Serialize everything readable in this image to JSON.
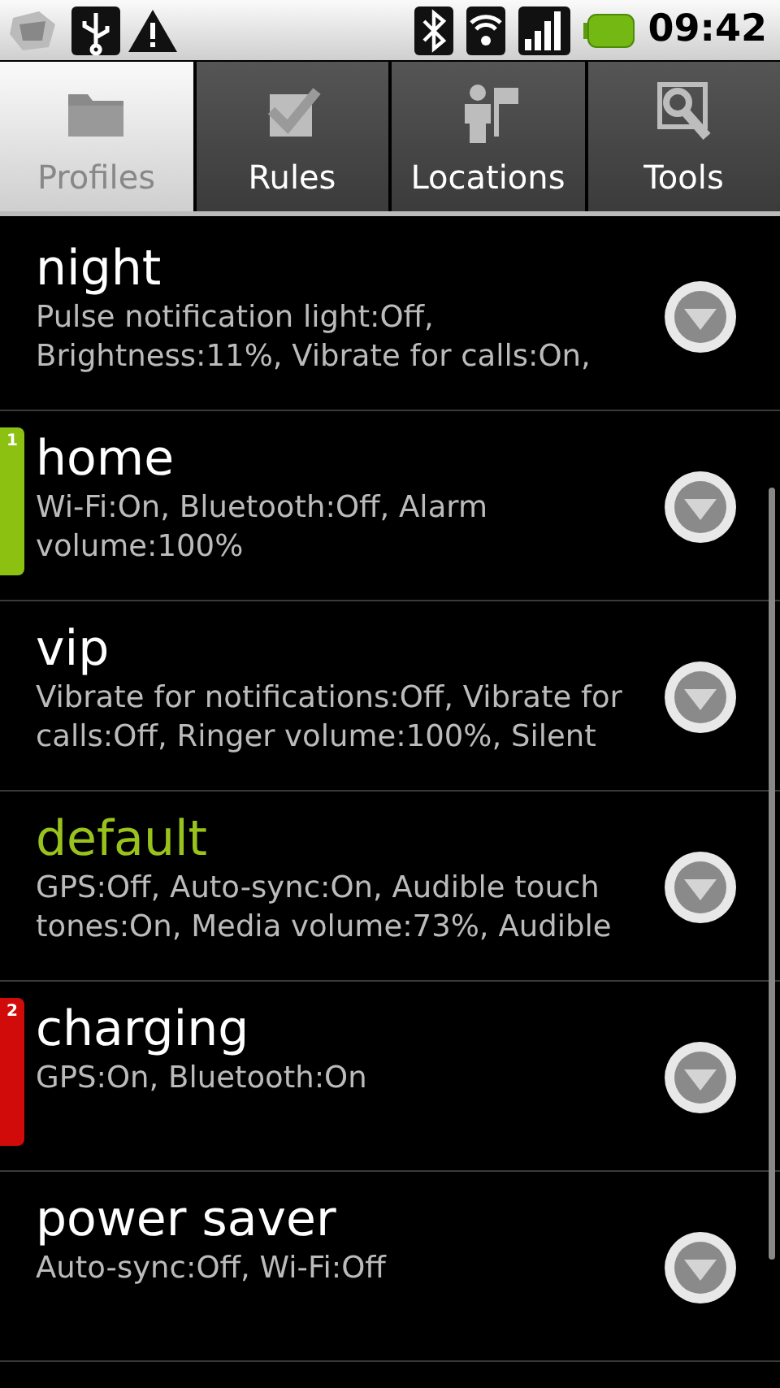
{
  "status_bar": {
    "time": "09:42"
  },
  "tabs": [
    {
      "label": "Profiles",
      "selected": true
    },
    {
      "label": "Rules",
      "selected": false
    },
    {
      "label": "Locations",
      "selected": false
    },
    {
      "label": "Tools",
      "selected": false
    }
  ],
  "profiles": [
    {
      "name": "night",
      "summary": "Pulse notification light:Off, Brightness:11%, Vibrate for calls:On,",
      "active": false
    },
    {
      "name": "home",
      "summary": "Wi-Fi:On, Bluetooth:Off, Alarm volume:100%",
      "active": false,
      "marker": {
        "label": "1",
        "color": "#8cc111"
      }
    },
    {
      "name": "vip",
      "summary": "Vibrate for notifications:Off, Vibrate for calls:Off, Ringer volume:100%, Silent",
      "active": false
    },
    {
      "name": "default",
      "summary": "GPS:Off, Auto-sync:On, Audible touch tones:On, Media volume:73%, Audible",
      "active": true
    },
    {
      "name": "charging",
      "summary": "GPS:On, Bluetooth:On",
      "active": false,
      "marker": {
        "label": "2",
        "color": "#d10a0a"
      }
    },
    {
      "name": "power saver",
      "summary": "Auto-sync:Off, Wi-Fi:Off",
      "active": false
    }
  ]
}
